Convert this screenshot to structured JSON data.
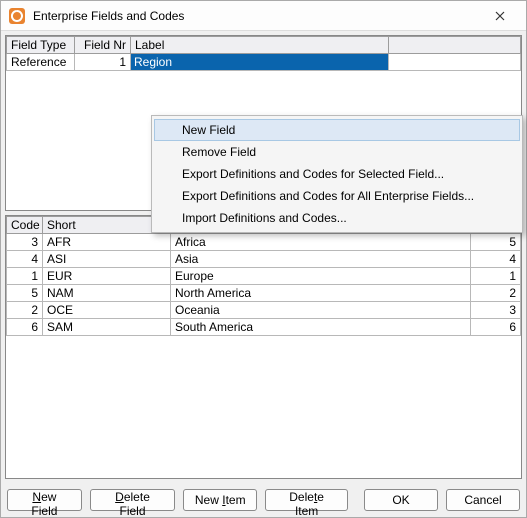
{
  "window": {
    "title": "Enterprise Fields and Codes"
  },
  "fields_table": {
    "headers": {
      "type": "Field Type",
      "nr": "Field Nr",
      "label": "Label"
    },
    "row": {
      "type": "Reference",
      "nr": "1",
      "label": "Region"
    }
  },
  "codes_table": {
    "headers": {
      "code": "Code",
      "short": "Short",
      "desc": "",
      "extra": ""
    },
    "rows": [
      {
        "code": "3",
        "short": "AFR",
        "desc": "Africa",
        "extra": "5"
      },
      {
        "code": "4",
        "short": "ASI",
        "desc": "Asia",
        "extra": "4"
      },
      {
        "code": "1",
        "short": "EUR",
        "desc": "Europe",
        "extra": "1"
      },
      {
        "code": "5",
        "short": "NAM",
        "desc": "North America",
        "extra": "2"
      },
      {
        "code": "2",
        "short": "OCE",
        "desc": "Oceania",
        "extra": "3"
      },
      {
        "code": "6",
        "short": "SAM",
        "desc": "South America",
        "extra": "6"
      }
    ]
  },
  "context_menu": {
    "items": [
      "New Field",
      "Remove Field",
      "Export Definitions and Codes for Selected Field...",
      "Export Definitions and Codes for All Enterprise Fields...",
      "Import Definitions and Codes..."
    ]
  },
  "buttons": {
    "new_field": {
      "mn": "N",
      "rest": "ew Field"
    },
    "delete_field": {
      "mn": "D",
      "rest": "elete Field"
    },
    "new_item": {
      "pre": "New ",
      "mn": "I",
      "rest": "tem"
    },
    "delete_item": {
      "pre": "Dele",
      "mn": "t",
      "rest": "e Item"
    },
    "ok": "OK",
    "cancel": "Cancel"
  }
}
